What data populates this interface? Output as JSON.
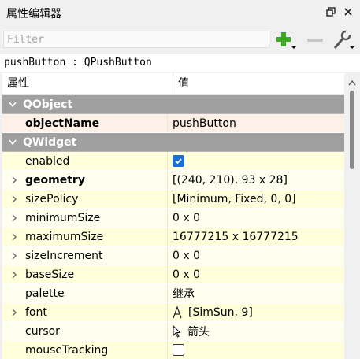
{
  "panel": {
    "title": "属性编辑器"
  },
  "filter": {
    "placeholder": "Filter"
  },
  "class_label": "pushButton : QPushButton",
  "table": {
    "col_property": "属性",
    "col_value": "值",
    "groups": {
      "qobject": "QObject",
      "qwidget": "QWidget"
    },
    "rows": {
      "objectName": {
        "name": "objectName",
        "value": "pushButton"
      },
      "enabled": {
        "name": "enabled",
        "checked": true
      },
      "geometry": {
        "name": "geometry",
        "value": "[(240, 210), 93 x 28]"
      },
      "sizePolicy": {
        "name": "sizePolicy",
        "value": "[Minimum, Fixed, 0, 0]"
      },
      "minimumSize": {
        "name": "minimumSize",
        "value": "0 x 0"
      },
      "maximumSize": {
        "name": "maximumSize",
        "value": "16777215 x 16777215"
      },
      "sizeIncrement": {
        "name": "sizeIncrement",
        "value": "0 x 0"
      },
      "baseSize": {
        "name": "baseSize",
        "value": "0 x 0"
      },
      "palette": {
        "name": "palette",
        "value": "继承"
      },
      "font": {
        "name": "font",
        "value": "[SimSun, 9]"
      },
      "cursor": {
        "name": "cursor",
        "value": "箭头"
      },
      "mouseTracking": {
        "name": "mouseTracking",
        "checked": false
      }
    }
  },
  "colors": {
    "group_header": "#a0a0a0",
    "row_yellow": "#ffffdc",
    "accent": "#1a6fd6"
  }
}
